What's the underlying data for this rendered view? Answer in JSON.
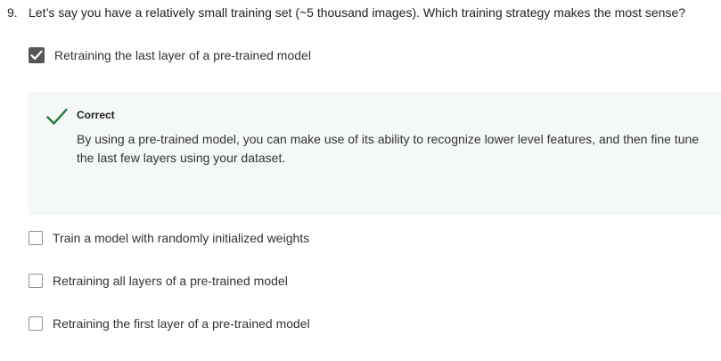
{
  "question": {
    "number": "9.",
    "text": "Let’s say you have a relatively small training set (~5 thousand images). Which training strategy makes the most sense?"
  },
  "options": [
    {
      "label": "Retraining the last layer of a pre-trained model",
      "checked": true
    },
    {
      "label": "Train a model with randomly initialized weights",
      "checked": false
    },
    {
      "label": "Retraining all layers of a pre-trained model",
      "checked": false
    },
    {
      "label": "Retraining the first layer of a pre-trained model",
      "checked": false
    }
  ],
  "feedback": {
    "status": "Correct",
    "explanation": "By using a pre-trained model, you can make use of its ability to recognize lower level features, and then fine tune the last few layers using your dataset.",
    "icon": "checkmark-icon",
    "accent_color": "#2a7a3b",
    "background_color": "#f4f8f6"
  }
}
